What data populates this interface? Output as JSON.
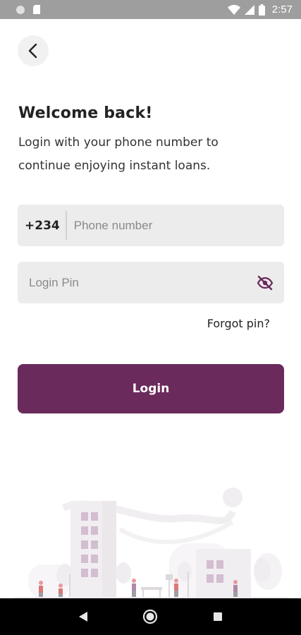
{
  "status_bar": {
    "time": "2:57",
    "icons": [
      "circle-indicator-icon",
      "sd-card-icon",
      "wifi-icon",
      "cell-signal-icon",
      "battery-icon"
    ]
  },
  "header": {
    "back_icon": "chevron-left-icon"
  },
  "welcome": {
    "title": "Welcome back!",
    "subtitle_line1": "Login with your phone number to",
    "subtitle_line2": "continue enjoying instant loans."
  },
  "phone": {
    "country_code": "+234",
    "placeholder": "Phone number",
    "value": ""
  },
  "pin": {
    "placeholder": "Login Pin",
    "value": "",
    "toggle_icon": "eye-off-icon"
  },
  "forgot_pin_label": "Forgot pin?",
  "login_button_label": "Login",
  "colors": {
    "primary": "#6a2a5b",
    "field_bg": "#ececec",
    "status_bar": "#9e9e9e",
    "illustration_accent": "#d3bdd0"
  },
  "nav_bar": {
    "icons": [
      "back-triangle-icon",
      "home-circle-icon",
      "recents-square-icon"
    ]
  }
}
